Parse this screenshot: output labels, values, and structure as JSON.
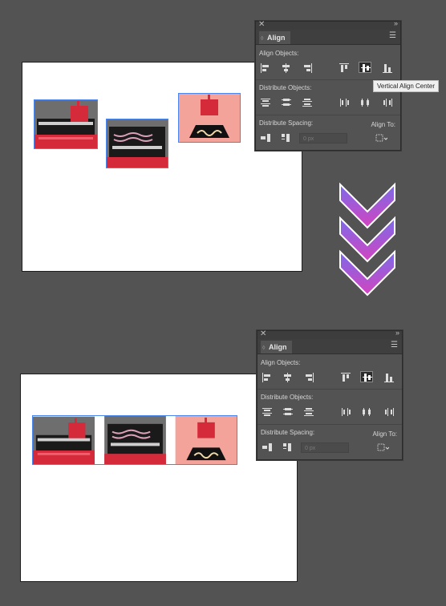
{
  "panel": {
    "tab_label": "Align",
    "align_objects": "Align Objects:",
    "distribute_objects": "Distribute Objects:",
    "distribute_spacing": "Distribute Spacing:",
    "align_to": "Align To:",
    "spacing_value": "0 px"
  },
  "tooltip": "Vertical Align Center",
  "icons": [
    "horizontal-align-left",
    "horizontal-align-center",
    "horizontal-align-right",
    "vertical-align-top",
    "vertical-align-center",
    "vertical-align-bottom"
  ],
  "colors": {
    "accent": "#4a86f0",
    "arrow_top": "#7b6be8",
    "arrow_bottom": "#d344c0"
  }
}
